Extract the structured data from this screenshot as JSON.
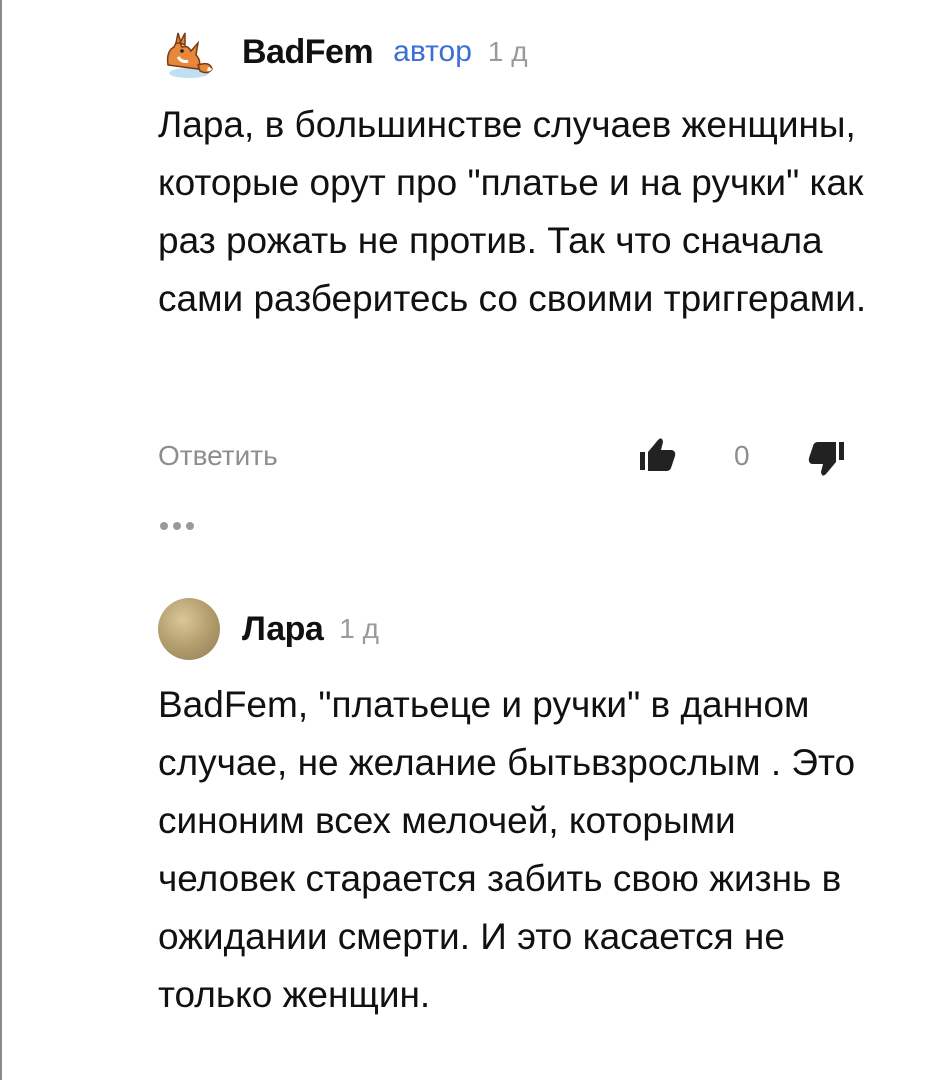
{
  "colors": {
    "author_badge": "#3a6fd8",
    "muted_text": "#8e8e8e",
    "body_text": "#111111",
    "icon_dark": "#222222"
  },
  "comments": [
    {
      "author": "BadFem",
      "badge": "автор",
      "time": "1 д",
      "avatar_icon": "fox-avatar-icon",
      "text": "Лара, в большинстве случаев женщины, которые орут про \"платье и на ручки\" как раз рожать не против. Так что сначала сами разберитесь со своими триггерами.",
      "reply_label": "Ответить",
      "votes": "0",
      "like_icon": "thumbs-up-icon",
      "dislike_icon": "thumbs-down-icon",
      "more_icon": "more-dots-icon"
    },
    {
      "author": "Лара",
      "time": "1 д",
      "avatar_icon": "user-photo-avatar",
      "text": "BadFem, \"платьеце и ручки\" в данном случае, не желание бытьвзрослым . Это синоним всех мелочей, которыми человек старается забить свою жизнь в ожидании смерти. И это касается не только женщин."
    }
  ]
}
